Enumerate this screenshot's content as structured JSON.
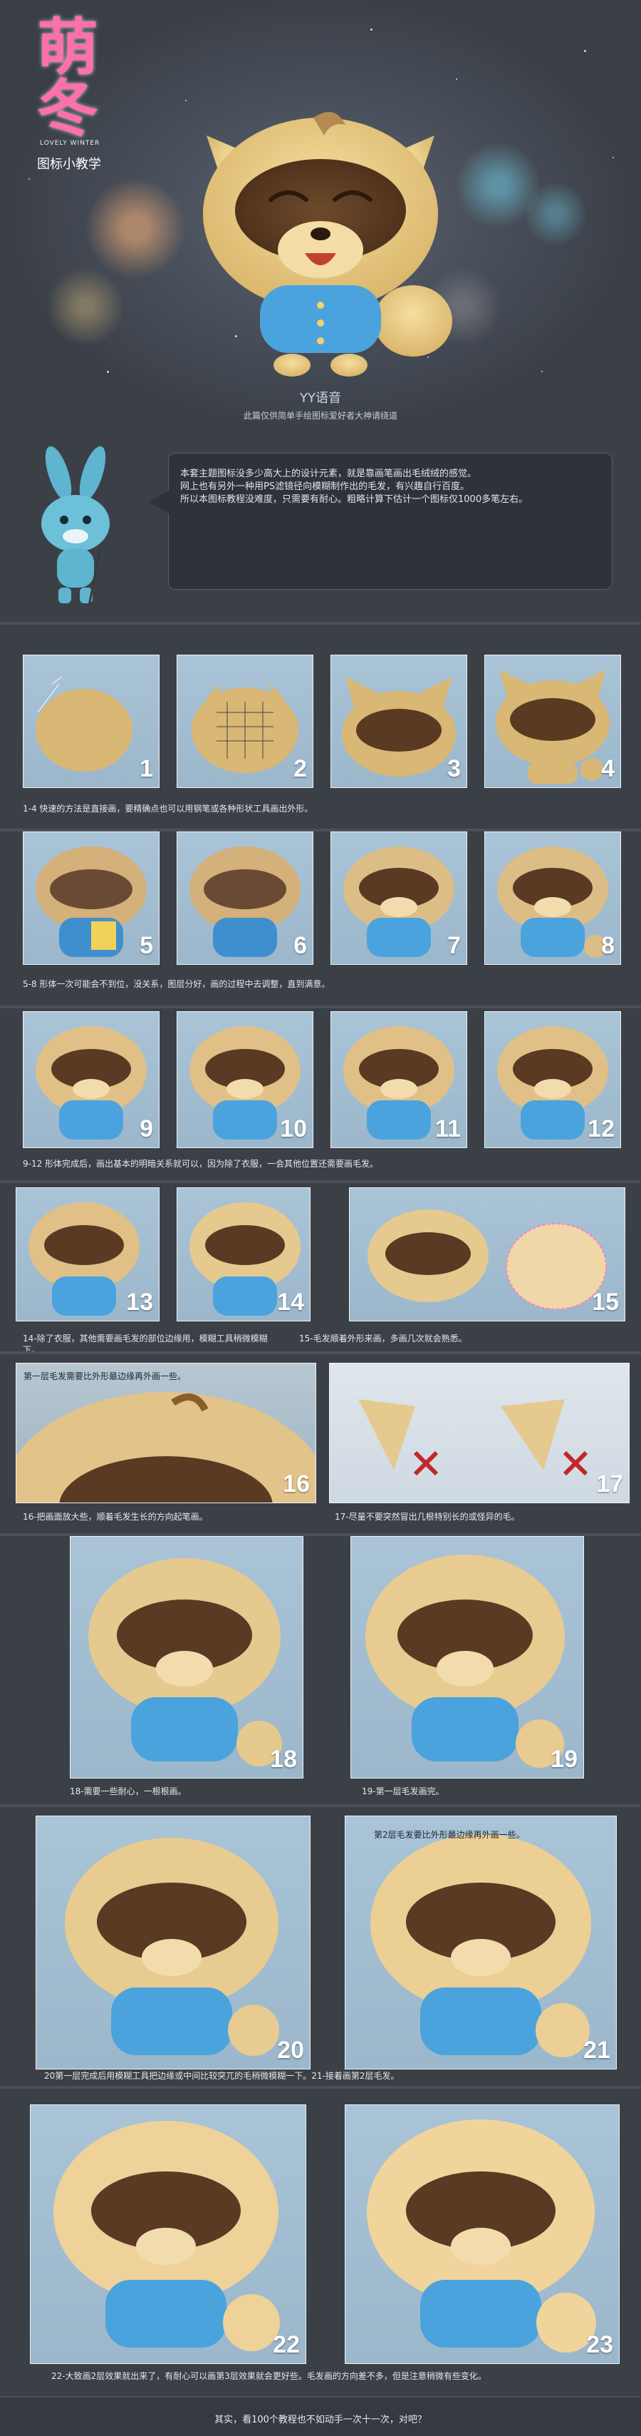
{
  "header": {
    "logo_mark": "萌冬",
    "logo_sub": "LOVELY WINTER",
    "subtitle": "图标小教学",
    "mascot_name": "YY语音",
    "caption": "此篇仅供简单手绘图标爱好者大神请绕道"
  },
  "intro": {
    "lines": [
      "本套主题图标没多少高大上的设计元素，就是靠画笔画出毛绒绒的感觉。",
      "网上也有另外一种用PS滤镜径向模糊制作出的毛发，有兴趣自行百度。",
      "所以本图标教程没难度，只需要有耐心。粗略计算下估计一个图标仅1000多笔左右。"
    ]
  },
  "steps": [
    {
      "n": "1"
    },
    {
      "n": "2"
    },
    {
      "n": "3"
    },
    {
      "n": "4"
    },
    {
      "n": "5"
    },
    {
      "n": "6"
    },
    {
      "n": "7"
    },
    {
      "n": "8"
    },
    {
      "n": "9"
    },
    {
      "n": "10"
    },
    {
      "n": "11"
    },
    {
      "n": "12"
    },
    {
      "n": "13"
    },
    {
      "n": "14"
    },
    {
      "n": "15"
    },
    {
      "n": "16"
    },
    {
      "n": "17"
    },
    {
      "n": "18"
    },
    {
      "n": "19"
    },
    {
      "n": "20"
    },
    {
      "n": "21"
    },
    {
      "n": "22"
    },
    {
      "n": "23"
    }
  ],
  "captions": {
    "c1_4": "1-4 快速的方法是直接画，要精确点也可以用钢笔或各种形状工具画出外形。",
    "c5_8": "5-8 形体一次可能会不到位，没关系，图层分好，画的过程中去调整，直到满意。",
    "c9_12": "9-12 形体完成后，画出基本的明暗关系就可以，因为除了衣服，一会其他位置还需要画毛发。",
    "c14": "14-除了衣服，其他需要画毛发的部位边缘用，模糊工具稍微模糊下。",
    "c15": "15-毛发顺着外形来画，多画几次就会熟悉。",
    "c16_note": "第一层毛发需要比外形最边缘再外画一些。",
    "c16": "16-把画面放大些，顺着毛发生长的方向起笔画。",
    "c17": "17-尽量不要突然冒出几根特别长的或怪异的毛。",
    "c18": "18-需要一些耐心，一根根画。",
    "c19": "19-第一层毛发画完。",
    "c21_note": "第2层毛发要比外形最边缘再外画一些。",
    "c20_21": "20第一层完成后用模糊工具把边缘或中间比较突兀的毛稍微模糊一下。21-接着画第2层毛发。",
    "c22_23": "22-大致画2层效果就出来了，有耐心可以画第3层效果就会更好些。毛发画的方向差不多，但是注意稍微有些变化。"
  },
  "footer": {
    "text": "其实，看100个教程也不如动手一次十一次，对吧？"
  },
  "colors": {
    "background": "#3b4047",
    "thumb_bg": "#a9c4d7",
    "fur": "#e8c77e",
    "mask": "#5a3a22",
    "shirt": "#4aa3dd",
    "marker_red": "#c0282a"
  }
}
